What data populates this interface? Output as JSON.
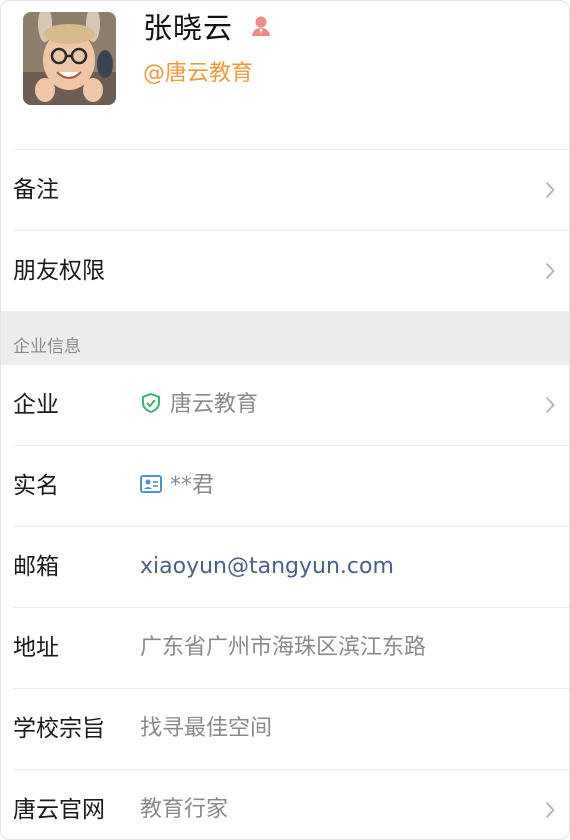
{
  "profile": {
    "name": "张晓云",
    "company_handle": "@唐云教育"
  },
  "actions": [
    {
      "label": "备注"
    },
    {
      "label": "朋友权限"
    }
  ],
  "section": {
    "title": "企业信息"
  },
  "info": {
    "company": {
      "label": "企业",
      "value": "唐云教育"
    },
    "real_name": {
      "label": "实名",
      "value": "**君"
    },
    "email": {
      "label": "邮箱",
      "value": "xiaoyun@tangyun.com"
    },
    "address": {
      "label": "地址",
      "value": "广东省广州市海珠区滨江东路"
    },
    "motto": {
      "label": "学校宗旨",
      "value": "找寻最佳空间"
    },
    "website": {
      "label": "唐云官网",
      "value": "教育行家"
    }
  },
  "colors": {
    "handle": "#ef9a3b",
    "link": "#4a5f8c",
    "verified_green": "#3fb36a",
    "id_blue": "#4d8fd6",
    "gender_icon": "#f08a88"
  },
  "icons": {
    "gender": "female-person-icon",
    "verified": "shield-check-icon",
    "id_card": "id-card-icon",
    "chevron": "chevron-right-icon"
  }
}
